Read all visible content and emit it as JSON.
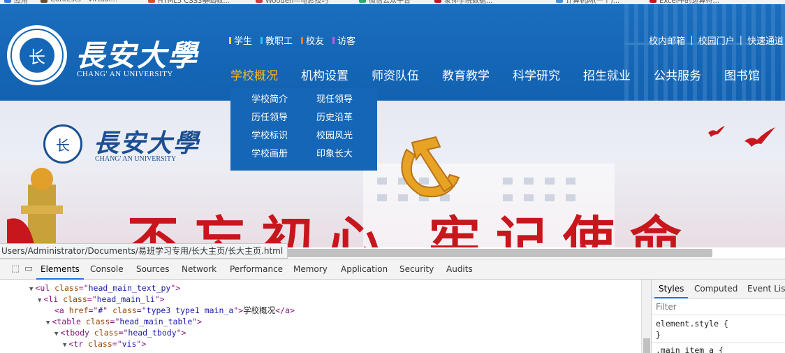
{
  "bookmarks": [
    {
      "label": "应用",
      "color": "#3b78e7"
    },
    {
      "label": "Contests - Virtual...",
      "color": "#6b4f2a"
    },
    {
      "label": "HTML5 CSS3基础教...",
      "color": "#e34c26"
    },
    {
      "label": "Wooden—电影技巧",
      "color": "#d23b3b"
    },
    {
      "label": "微信公众平台",
      "color": "#2aae67"
    },
    {
      "label": "蒙师学院数据...",
      "color": "#c8161d"
    },
    {
      "label": "计算机网(一个)...",
      "color": "#4a90d9"
    },
    {
      "label": "Excel中的运算符...",
      "color": "#c8161d"
    }
  ],
  "header": {
    "logo_cn": "長安大學",
    "logo_en": "CHANG' AN UNIVERSITY",
    "emblem_text": "长",
    "user_links": [
      {
        "label": "学生",
        "color": "#f7e21e"
      },
      {
        "label": "教职工",
        "color": "#2ec3f2"
      },
      {
        "label": "校友",
        "color": "#f07a3c"
      },
      {
        "label": "访客",
        "color": "#c35ce0"
      }
    ],
    "top_right_links": [
      "校内邮箱",
      "校园门户",
      "快速通道"
    ],
    "nav": [
      {
        "label": "学校概况",
        "active": true
      },
      {
        "label": "机构设置",
        "active": false
      },
      {
        "label": "师资队伍",
        "active": false
      },
      {
        "label": "教育教学",
        "active": false
      },
      {
        "label": "科学研究",
        "active": false
      },
      {
        "label": "招生就业",
        "active": false
      },
      {
        "label": "公共服务",
        "active": false
      },
      {
        "label": "图书馆",
        "active": false
      }
    ],
    "dropdown": [
      "学校简介",
      "现任领导",
      "历任领导",
      "历史沿革",
      "学校标识",
      "校园风光",
      "学校画册",
      "印象长大"
    ]
  },
  "banner": {
    "logo_cn": "長安大學",
    "logo_en": "CHANG' AN UNIVERSITY",
    "emblem_text": "长",
    "slogan": "不忘初心 牢记使命"
  },
  "status_url": "Users/Administrator/Documents/易班学习专用/长大主页/长大主页.html",
  "devtools": {
    "tabs": [
      "Elements",
      "Console",
      "Sources",
      "Network",
      "Performance",
      "Memory",
      "Application",
      "Security",
      "Audits"
    ],
    "active_tab": "Elements",
    "code": [
      {
        "open": "ul",
        "attr": "class",
        "val": "head_main_text_py",
        "text": "",
        "close": ""
      },
      {
        "open": "li",
        "attr": "class",
        "val": "head_main_li",
        "text": "",
        "close": ""
      },
      {
        "open": "a",
        "attr": "href",
        "val": "#",
        "attr2": "class",
        "val2": "type3 type1 main_a",
        "text": "学校概况",
        "close": "a"
      },
      {
        "open": "table",
        "attr": "class",
        "val": "head_main_table",
        "text": "",
        "close": ""
      },
      {
        "open": "tbody",
        "attr": "class",
        "val": "head_tbody",
        "text": "",
        "close": ""
      },
      {
        "open": "tr",
        "attr": "class",
        "val": "vis",
        "text": "",
        "close": ""
      }
    ],
    "styles_tabs": [
      "Styles",
      "Computed",
      "Event Listeners"
    ],
    "filter_placeholder": "Filter",
    "rule1_selector": "element.style {",
    "rule1_close": "}",
    "rule2_selector": ".main_item a {"
  }
}
